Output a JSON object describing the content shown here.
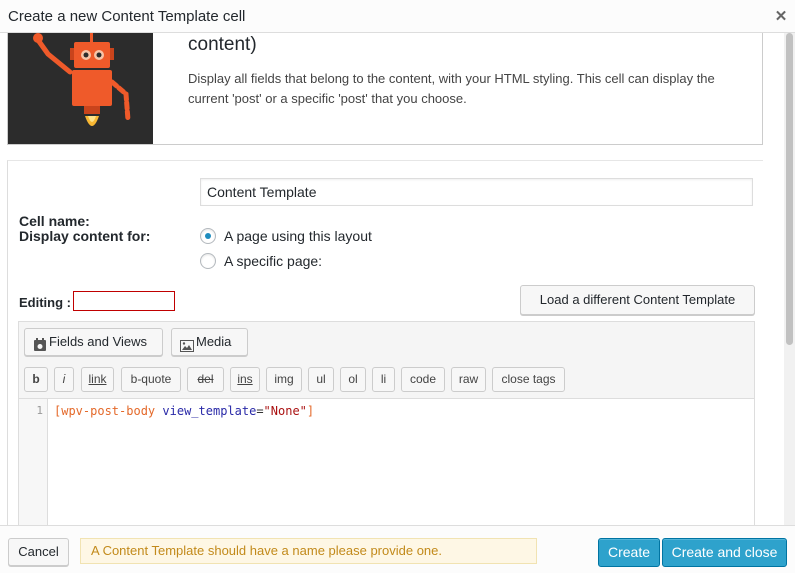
{
  "dialog": {
    "title": "Create a new Content Template cell",
    "close_icon": "close-icon"
  },
  "intro": {
    "heading_partial": "content)",
    "description": "Display all fields that belong to the content, with your HTML styling. This cell can display the current 'post' or a specific 'post' that you choose.",
    "thumbnail": "robot-illustration",
    "colors": {
      "thumb_bg": "#2c2c2c",
      "robot": "#ef5a2a"
    }
  },
  "form": {
    "cell_name_label": "Cell name:",
    "cell_name_value": "Content Template",
    "display_for_label": "Display content for:",
    "display_options": [
      {
        "label": "A page using this layout",
        "checked": true
      },
      {
        "label": "A specific page:",
        "checked": false
      }
    ],
    "editing_label": "Editing :",
    "editing_value": "",
    "load_button": "Load a different Content Template"
  },
  "editor": {
    "fields_views_button": "Fields and Views",
    "media_button": "Media",
    "quicktags": [
      "b",
      "i",
      "link",
      "b-quote",
      "del",
      "ins",
      "img",
      "ul",
      "ol",
      "li",
      "code",
      "raw",
      "close tags"
    ],
    "line_numbers": [
      "1"
    ],
    "code": {
      "open": "[",
      "tag": "wpv-post-body",
      "attr": "view_template",
      "eq": "=",
      "value": "\"None\"",
      "close": "]"
    }
  },
  "footer": {
    "cancel": "Cancel",
    "warning": "A Content Template should have a name please provide one.",
    "create": "Create",
    "create_close": "Create and close",
    "colors": {
      "primary": "#2ea2cc",
      "warning_bg": "#fef7e5",
      "warning_text": "#c28a1b"
    }
  }
}
